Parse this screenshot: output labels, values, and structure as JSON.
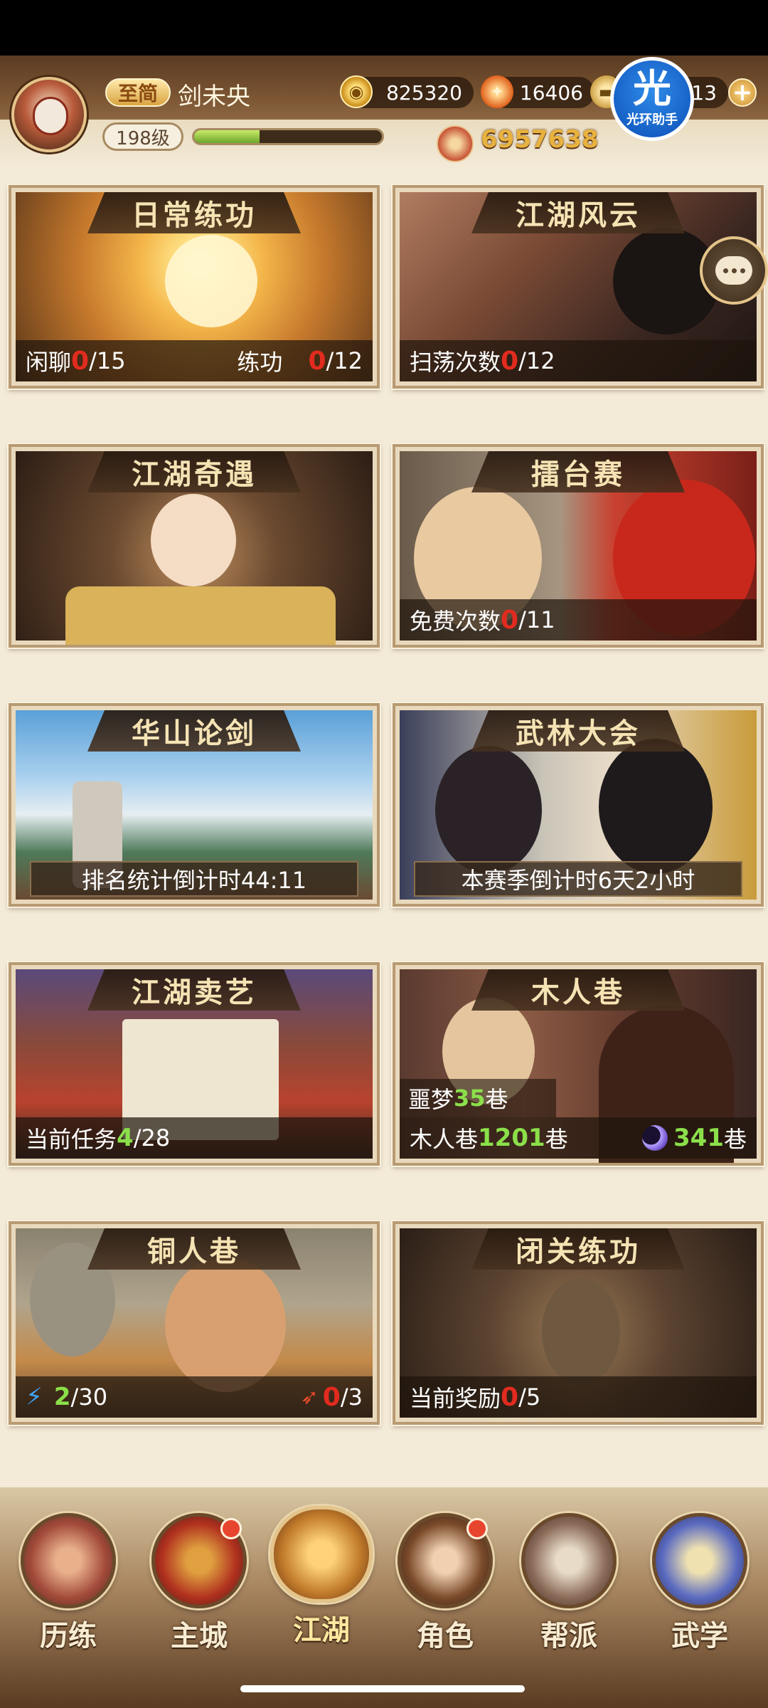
{
  "player": {
    "vip_label": "至简",
    "name": "剑未央",
    "level": "198级",
    "xp_fraction": 0.35,
    "power": "6957638"
  },
  "resources": {
    "coins": "825320",
    "gems": "16406",
    "ingots": "713"
  },
  "assistant": {
    "icon_text": "光",
    "label": "光环助手"
  },
  "cards": [
    {
      "title": "日常练功",
      "info": [
        {
          "label": "闲聊 ",
          "current": "0",
          "total": "/15"
        },
        {
          "label": "练功 ",
          "current": "0",
          "total": "/12"
        }
      ]
    },
    {
      "title": "江湖风云",
      "info": [
        {
          "label": "扫荡次数 ",
          "current": "0",
          "total": "/12"
        }
      ]
    },
    {
      "title": "江湖奇遇"
    },
    {
      "title": "擂台赛",
      "info": [
        {
          "label": "免费次数 ",
          "current": "0",
          "total": "/11"
        }
      ]
    },
    {
      "title": "华山论剑",
      "countdown": "排名统计倒计时44:11"
    },
    {
      "title": "武林大会",
      "countdown": "本赛季倒计时6天2小时"
    },
    {
      "title": "江湖卖艺",
      "info": [
        {
          "label": "当前任务 ",
          "current": "4",
          "total": "/28"
        }
      ]
    },
    {
      "title": "木人巷",
      "nightmare": {
        "label": "噩梦",
        "value": "35",
        "unit": "巷"
      },
      "main": {
        "label": "木人巷",
        "value": "1201",
        "unit": "巷"
      },
      "moon": {
        "value": "341",
        "unit": "巷"
      }
    },
    {
      "title": "铜人巷",
      "energy": {
        "current": "2",
        "total": "/30"
      },
      "tries": {
        "current": "0",
        "total": "/3"
      }
    },
    {
      "title": "闭关练功",
      "info": [
        {
          "label": "当前奖励 ",
          "current": "0",
          "total": "/5"
        }
      ]
    }
  ],
  "nav": [
    {
      "label": "历练",
      "icon": "scroll-sword-icon",
      "badge": false
    },
    {
      "label": "主城",
      "icon": "palace-icon",
      "badge": true
    },
    {
      "label": "江湖",
      "icon": "gourd-sword-icon",
      "badge": false,
      "active": true
    },
    {
      "label": "角色",
      "icon": "character-icon",
      "badge": true
    },
    {
      "label": "帮派",
      "icon": "guild-emblem-icon",
      "badge": false
    },
    {
      "label": "武学",
      "icon": "scrolls-icon",
      "badge": false
    }
  ],
  "colors": {
    "accent_red": "#e22b1f",
    "accent_green": "#8be04a",
    "title_gold": "#f6e3b4",
    "power_gold": "#e8b23e"
  }
}
